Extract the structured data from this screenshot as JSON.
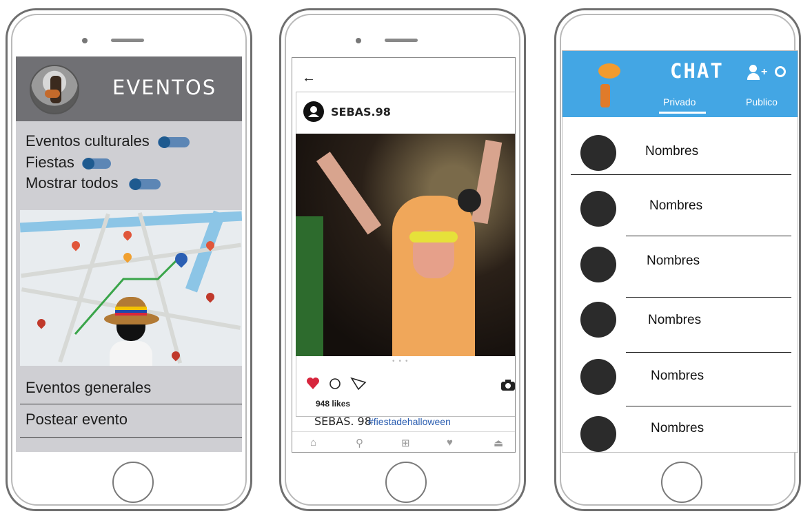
{
  "phone1": {
    "header_title": "EVENTOS",
    "filters": [
      "Eventos culturales",
      "Fiestas",
      "Mostrar todos"
    ],
    "menu_items": [
      "Eventos generales",
      "Postear evento"
    ]
  },
  "phone2": {
    "username": "SEBAS.98",
    "likes": "948 likes",
    "caption_user": "SEBAS. 98",
    "caption_tag": "#fiestadehalloween"
  },
  "phone3": {
    "header_title": "CHAT",
    "add_user_label": "+",
    "tabs": [
      "Privado",
      "Publico"
    ],
    "contacts": [
      "Nombres",
      "Nombres",
      "Nombres",
      "Nombres",
      "Nombres",
      "Nombres"
    ]
  },
  "colors": {
    "chat_header": "#43a6e4",
    "eventos_header": "#707074",
    "like_heart": "#d7263d",
    "toggle": "#1e5a8f"
  }
}
